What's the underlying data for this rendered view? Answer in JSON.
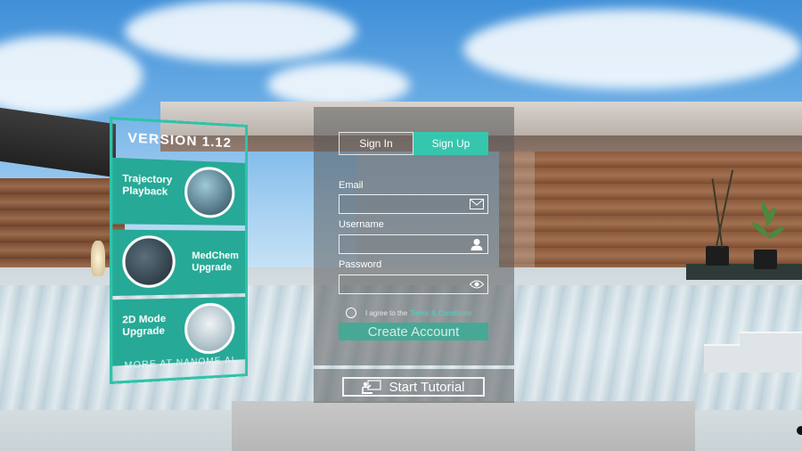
{
  "version_panel": {
    "title": "VERSION 1.12",
    "features": [
      {
        "label_line1": "Trajectory",
        "label_line2": "Playback"
      },
      {
        "label_line1": "MedChem",
        "label_line2": "Upgrade"
      },
      {
        "label_line1": "2D Mode",
        "label_line2": "Upgrade"
      }
    ],
    "footer": "MORE AT NANOME.AI",
    "accent_color": "#2fc3a9"
  },
  "auth": {
    "tabs": [
      {
        "label": "Sign In",
        "active": false
      },
      {
        "label": "Sign Up",
        "active": true
      }
    ],
    "fields": {
      "email": {
        "label": "Email",
        "value": "",
        "icon": "envelope-icon"
      },
      "username": {
        "label": "Username",
        "value": "",
        "icon": "user-icon"
      },
      "password": {
        "label": "Password",
        "value": "",
        "icon": "eye-icon"
      }
    },
    "agree_text": "I agree to the",
    "terms_link": "Terms & Conditions",
    "create_button": "Create Account",
    "accent_color": "#36c6ad"
  },
  "tutorial": {
    "button": "Start Tutorial",
    "icon": "teacher-icon"
  }
}
